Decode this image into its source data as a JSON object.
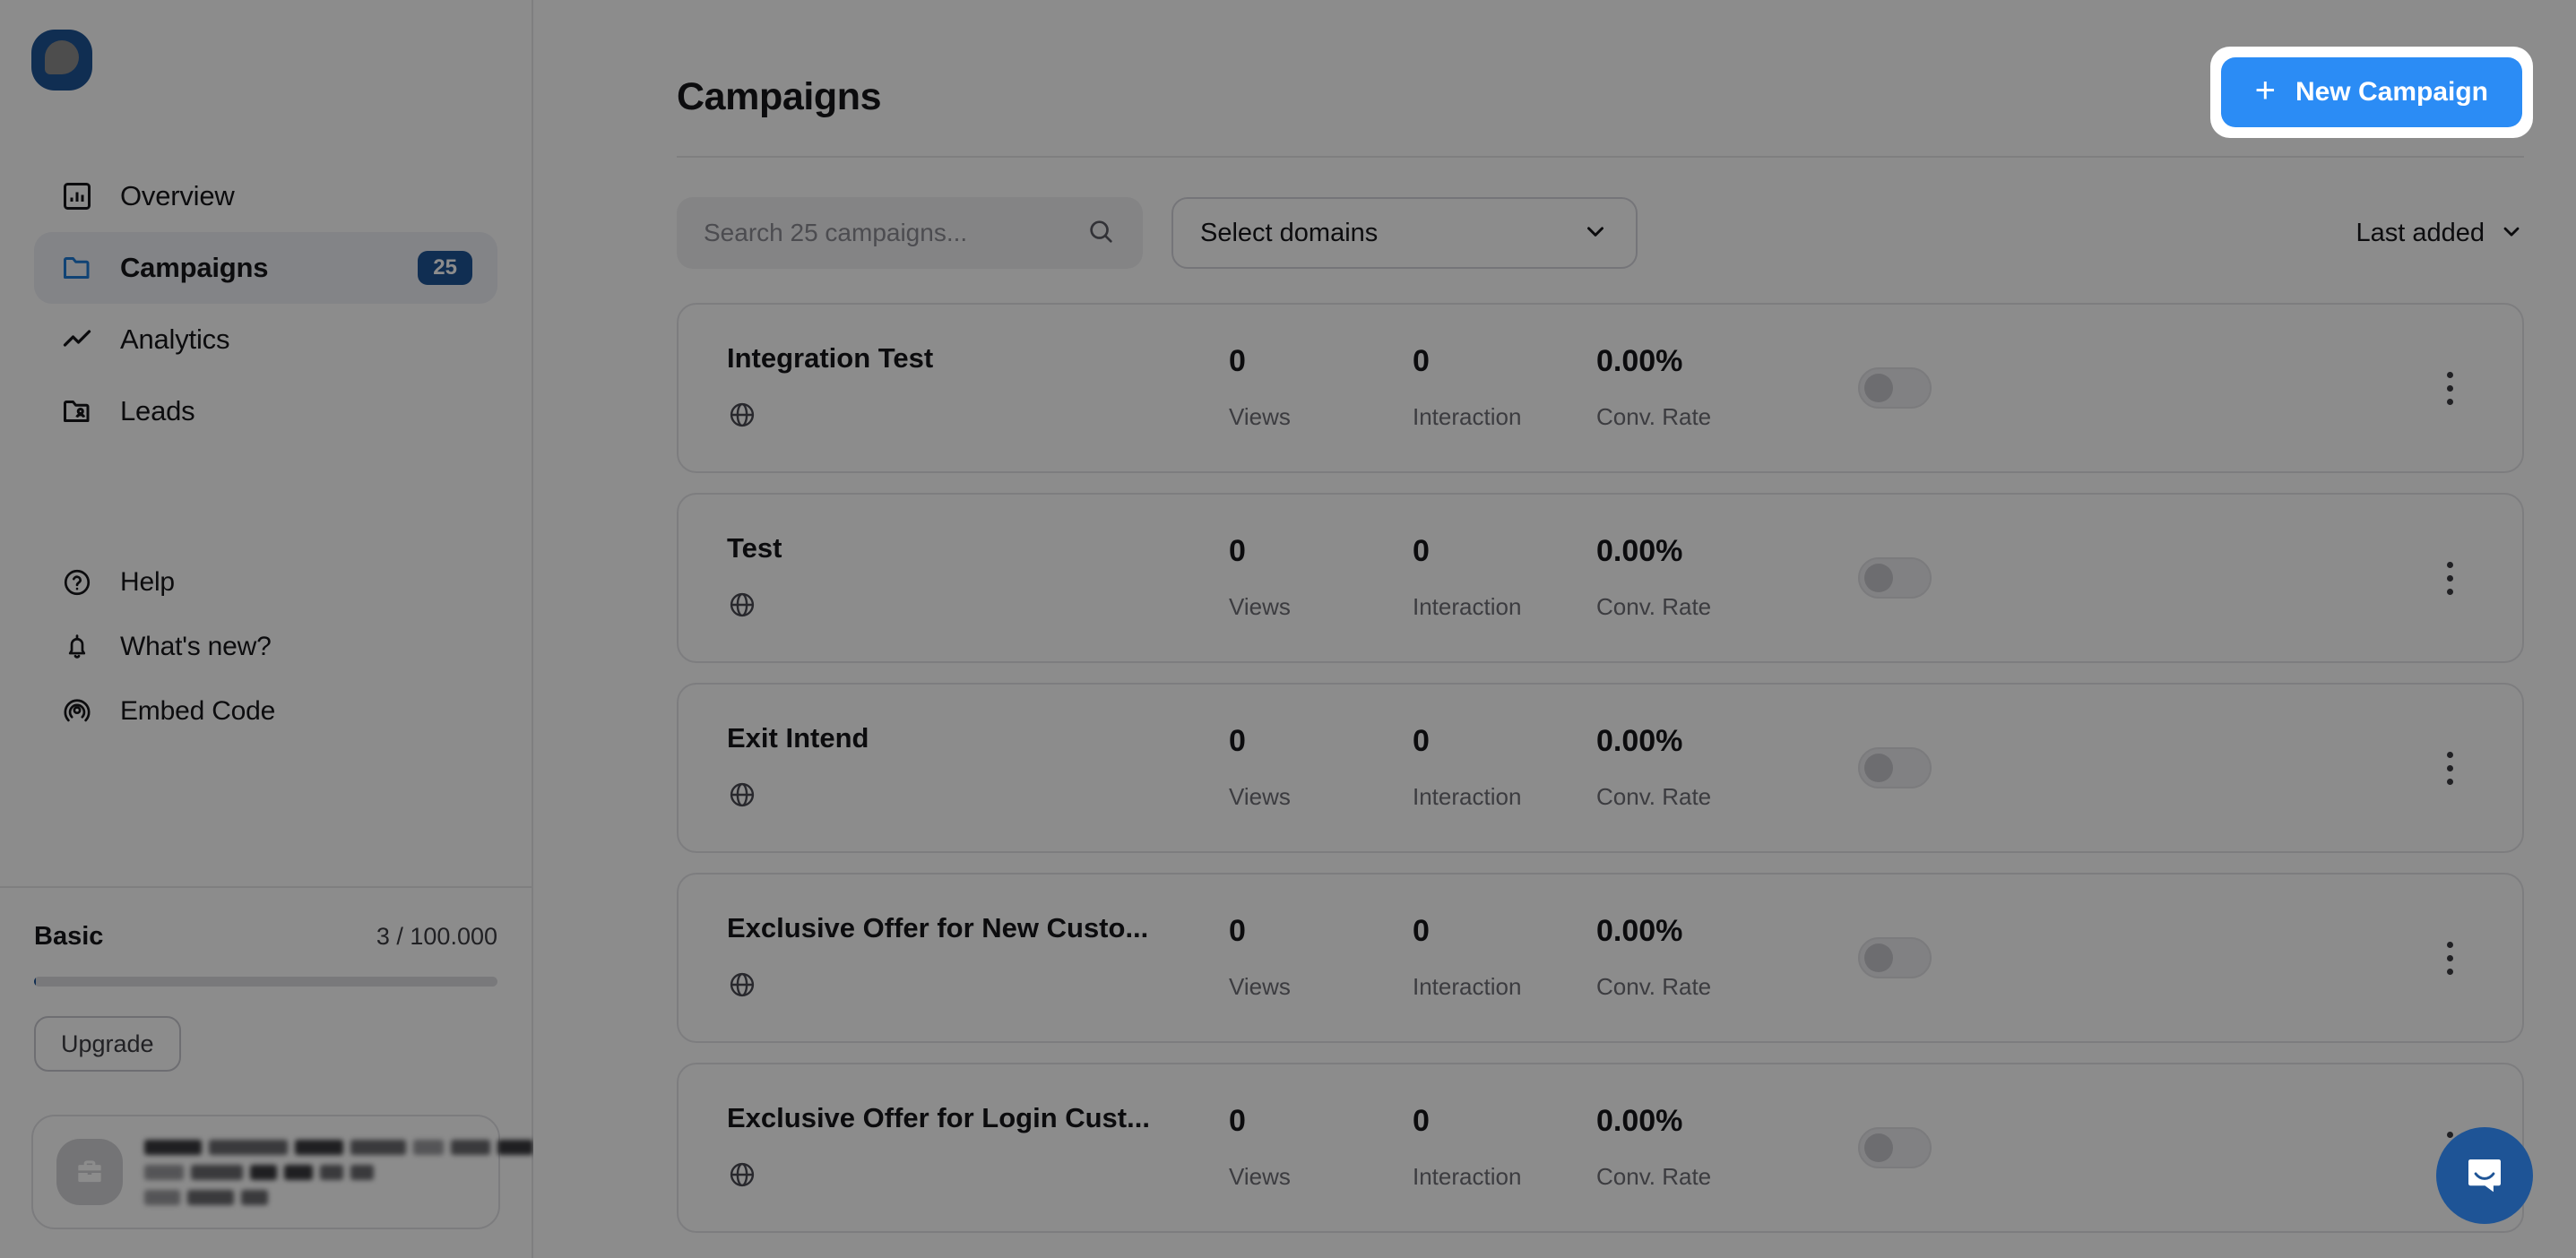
{
  "app": {
    "logo_icon": "pop-logo-icon",
    "accent_color": "#1e5496",
    "cta_color": "#2b8cf5"
  },
  "sidebar": {
    "primary_items": [
      {
        "label": "Overview",
        "icon": "chart-square-icon",
        "badge": null,
        "active": false
      },
      {
        "label": "Campaigns",
        "icon": "folder-icon",
        "badge": "25",
        "active": true
      },
      {
        "label": "Analytics",
        "icon": "trend-line-icon",
        "badge": null,
        "active": false
      },
      {
        "label": "Leads",
        "icon": "folder-user-icon",
        "badge": null,
        "active": false
      }
    ],
    "secondary_items": [
      {
        "label": "Help",
        "icon": "question-circle-icon"
      },
      {
        "label": "What's new?",
        "icon": "bell-icon"
      },
      {
        "label": "Embed Code",
        "icon": "target-radar-icon"
      }
    ],
    "plan": {
      "name": "Basic",
      "usage": "3 / 100.000",
      "progress_percent": 0.003,
      "upgrade_label": "Upgrade"
    },
    "profile": {
      "avatar_icon": "briefcase-icon",
      "name_redacted": true,
      "detail_redacted": true
    }
  },
  "header": {
    "title": "Campaigns",
    "new_campaign_label": "New Campaign",
    "new_campaign_icon": "plus-icon",
    "highlighted": true
  },
  "filters": {
    "search_placeholder": "Search 25 campaigns...",
    "search_value": "",
    "search_icon": "search-icon",
    "domain_select_label": "Select domains",
    "domain_select_icon": "chevron-down-icon",
    "sort_label": "Last added",
    "sort_icon": "chevron-down-icon"
  },
  "campaign_list": {
    "metric_labels": {
      "views": "Views",
      "interaction": "Interaction",
      "conv_rate": "Conv. Rate"
    },
    "rows": [
      {
        "name": "Integration Test",
        "domain_icon": "globe-icon",
        "views": "0",
        "interaction": "0",
        "conv_rate": "0.00%",
        "enabled": false
      },
      {
        "name": "Test",
        "domain_icon": "globe-icon",
        "views": "0",
        "interaction": "0",
        "conv_rate": "0.00%",
        "enabled": false
      },
      {
        "name": "Exit Intend",
        "domain_icon": "globe-icon",
        "views": "0",
        "interaction": "0",
        "conv_rate": "0.00%",
        "enabled": false
      },
      {
        "name": "Exclusive Offer for New Custo...",
        "domain_icon": "globe-icon",
        "views": "0",
        "interaction": "0",
        "conv_rate": "0.00%",
        "enabled": false
      },
      {
        "name": "Exclusive Offer for Login Cust...",
        "domain_icon": "globe-icon",
        "views": "0",
        "interaction": "0",
        "conv_rate": "0.00%",
        "enabled": false
      }
    ]
  },
  "support": {
    "launcher_icon": "chat-bubble-icon"
  }
}
